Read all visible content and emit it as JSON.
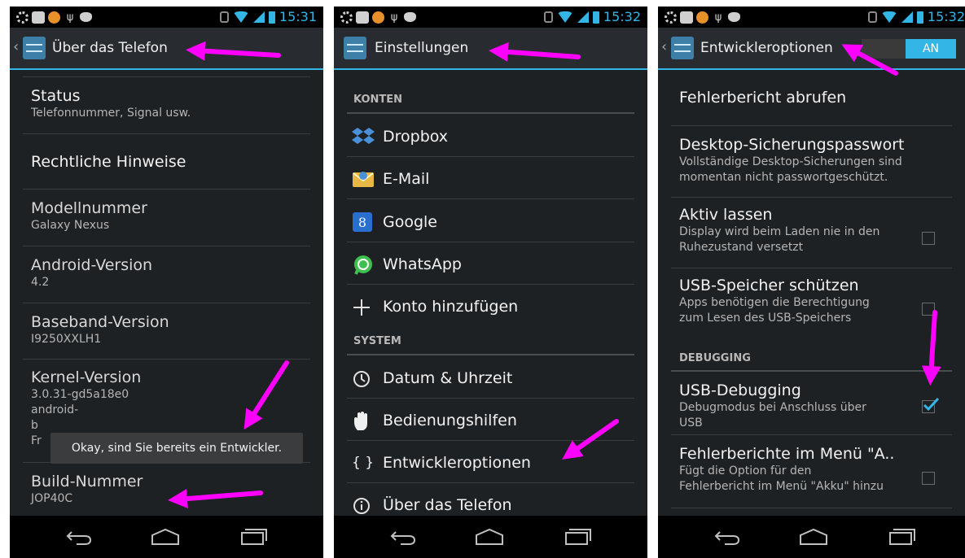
{
  "colors": {
    "accent": "#33b5e5",
    "arrow": "#ff00ff",
    "background": "#1e2124"
  },
  "phone1": {
    "status_time": "15:31",
    "title": "Über das Telefon",
    "items": [
      {
        "title": "Status",
        "subtitle": "Telefonnummer, Signal usw."
      },
      {
        "title": "Rechtliche Hinweise",
        "subtitle": ""
      },
      {
        "title": "Modellnummer",
        "subtitle": "Galaxy Nexus"
      },
      {
        "title": "Android-Version",
        "subtitle": "4.2"
      },
      {
        "title": "Baseband-Version",
        "subtitle": "I9250XXLH1"
      },
      {
        "title": "Kernel-Version",
        "subtitle": "3.0.31-gd5a18e0",
        "subtitle2": "android-",
        "subtitle3": "b",
        "subtitle4": "Fr"
      },
      {
        "title": "Build-Nummer",
        "subtitle": "JOP40C"
      }
    ],
    "toast": "Okay, sind Sie bereits ein Entwickler."
  },
  "phone2": {
    "status_time": "15:32",
    "title": "Einstellungen",
    "section_accounts": "KONTEN",
    "accounts": [
      {
        "label": "Dropbox",
        "icon": "dropbox-icon"
      },
      {
        "label": "E-Mail",
        "icon": "email-icon"
      },
      {
        "label": "Google",
        "icon": "google-icon"
      },
      {
        "label": "WhatsApp",
        "icon": "whatsapp-icon"
      },
      {
        "label": "Konto hinzufügen",
        "icon": "plus-icon"
      }
    ],
    "section_system": "SYSTEM",
    "system": [
      {
        "label": "Datum & Uhrzeit",
        "icon": "clock-icon"
      },
      {
        "label": "Bedienungshilfen",
        "icon": "hand-icon"
      },
      {
        "label": "Entwickleroptionen",
        "icon": "braces-icon",
        "glyph": "{ }"
      },
      {
        "label": "Über das Telefon",
        "icon": "info-icon"
      }
    ]
  },
  "phone3": {
    "status_time": "15:32",
    "title": "Entwickleroptionen",
    "toggle_label": "AN",
    "items": [
      {
        "title": "Fehlerbericht abrufen"
      },
      {
        "title": "Desktop-Sicherungspasswort",
        "sub1": "Vollständige Desktop-Sicherungen sind",
        "sub2": "momentan nicht passwortgeschützt."
      },
      {
        "title": "Aktiv lassen",
        "sub1": "Display wird beim Laden nie in den",
        "sub2": "Ruhezustand versetzt",
        "checked": false
      },
      {
        "title": "USB-Speicher schützen",
        "sub1": "Apps benötigen die Berechtigung",
        "sub2": "zum Lesen des USB-Speichers",
        "checked": false
      },
      {
        "title": "USB-Debugging",
        "sub1": "Debugmodus bei Anschluss über",
        "sub2": "USB",
        "checked": true
      },
      {
        "title": "Fehlerberichte im Menü \"A..",
        "sub1": "Fügt die Option für den",
        "sub2": "Fehlerbericht im Menü \"Akku\" hinzu",
        "checked": false
      }
    ],
    "section_debugging": "DEBUGGING"
  }
}
